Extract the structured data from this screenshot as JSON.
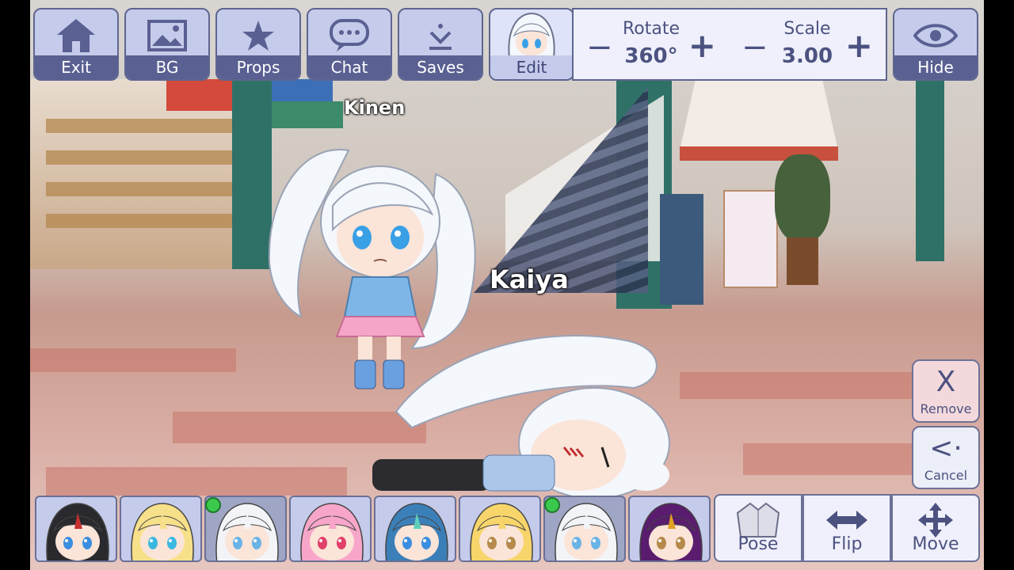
{
  "toolbar": {
    "exit": "Exit",
    "bg": "BG",
    "props": "Props",
    "chat": "Chat",
    "saves": "Saves",
    "edit": "Edit",
    "rotate_title": "Rotate",
    "rotate_value": "360°",
    "scale_title": "Scale",
    "scale_value": "3.00",
    "hide": "Hide",
    "minus": "−",
    "plus": "+"
  },
  "scene": {
    "characters": [
      {
        "name": "Kinen"
      },
      {
        "name": "Kaiya"
      }
    ]
  },
  "side": {
    "remove": "Remove",
    "remove_symbol": "X",
    "cancel": "Cancel",
    "cancel_symbol": "<·"
  },
  "bottom": {
    "slots": [
      {
        "hair": "#2a2a2e",
        "accent": "#c7302f",
        "eyes": "#3a8ee0",
        "selected": false
      },
      {
        "hair": "#f7e08a",
        "accent": "#f7e08a",
        "eyes": "#3bb8e0",
        "selected": false
      },
      {
        "hair": "#f2f4f8",
        "accent": "#f2f4f8",
        "eyes": "#6ab3e6",
        "selected": true
      },
      {
        "hair": "#f7a6c9",
        "accent": "#f7a6c9",
        "eyes": "#e0406a",
        "selected": false
      },
      {
        "hair": "#3b7fb8",
        "accent": "#5fd0b8",
        "eyes": "#3a8ee0",
        "selected": false
      },
      {
        "hair": "#f7d56a",
        "accent": "#f7d56a",
        "eyes": "#b58a4a",
        "selected": false
      },
      {
        "hair": "#f2f4f8",
        "accent": "#f2f4f8",
        "eyes": "#6ab3e6",
        "selected": true
      },
      {
        "hair": "#5a1c6e",
        "accent": "#e0a020",
        "eyes": "#b58a4a",
        "selected": false
      }
    ],
    "pose": "Pose",
    "flip": "Flip",
    "move": "Move"
  }
}
